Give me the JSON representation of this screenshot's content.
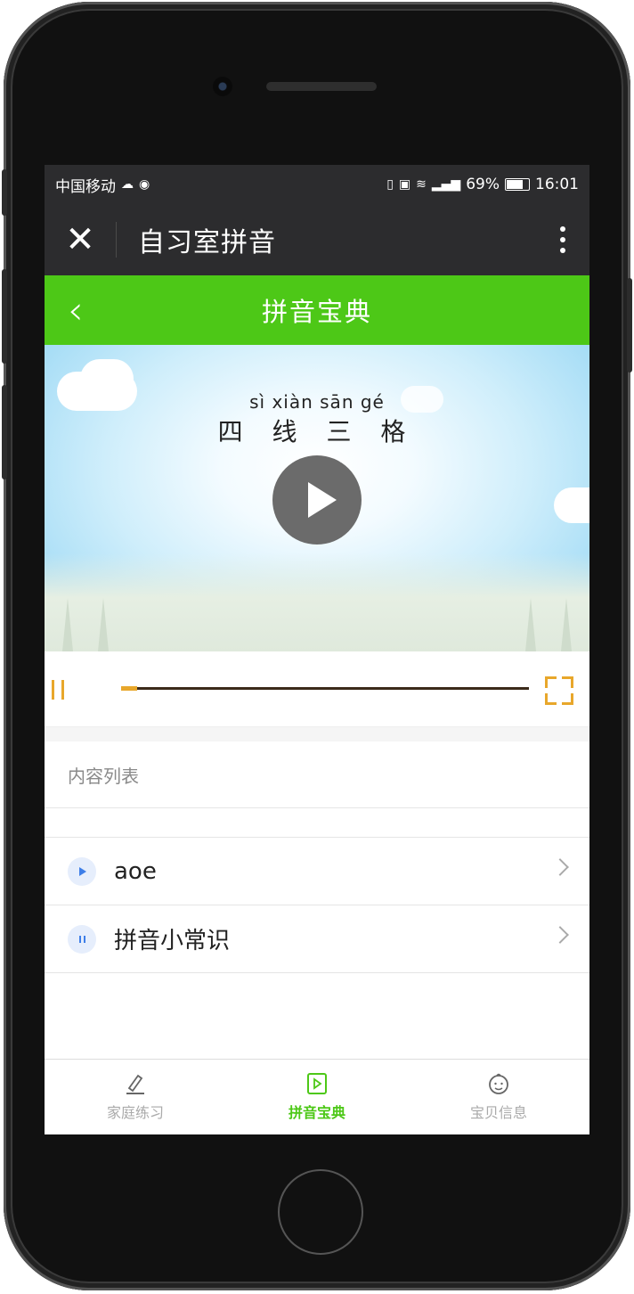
{
  "status_bar": {
    "carrier": "中国移动",
    "battery": "69%",
    "time": "16:01"
  },
  "title_bar": {
    "title": "自习室拼音"
  },
  "page_header": {
    "title": "拼音宝典"
  },
  "video": {
    "pinyin": "sì xiàn sān gé",
    "hanzi": "四 线 三 格",
    "progress": 0.04
  },
  "content": {
    "section_title": "内容列表",
    "items": [
      {
        "label": "aoe",
        "icon": "play-icon"
      },
      {
        "label": "拼音小常识",
        "icon": "pause-icon"
      }
    ]
  },
  "tabs": [
    {
      "label": "家庭练习",
      "icon": "pencil-icon",
      "active": false
    },
    {
      "label": "拼音宝典",
      "icon": "video-icon",
      "active": true
    },
    {
      "label": "宝贝信息",
      "icon": "baby-face-icon",
      "active": false
    }
  ],
  "colors": {
    "accent_green": "#4dc817",
    "progress_orange": "#e8a72b",
    "dark_bar": "#2c2c2e"
  }
}
